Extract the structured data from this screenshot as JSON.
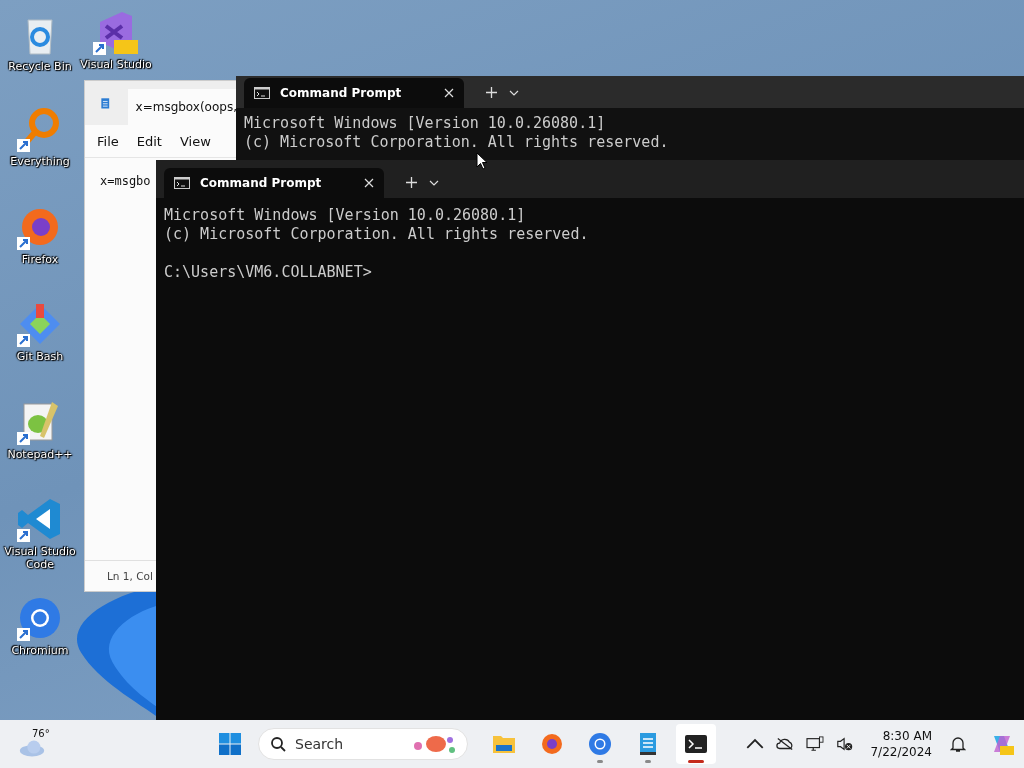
{
  "desktop_icons": [
    {
      "label": "Recycle Bin",
      "kind": "recycle-bin",
      "shortcut": false
    },
    {
      "label": "Visual Studio",
      "kind": "visual-studio",
      "shortcut": true
    },
    {
      "label": "Everything",
      "kind": "everything",
      "shortcut": true
    },
    {
      "label": "Firefox",
      "kind": "firefox",
      "shortcut": true
    },
    {
      "label": "Git Bash",
      "kind": "git-bash",
      "shortcut": true
    },
    {
      "label": "Notepad++",
      "kind": "notepad-plus",
      "shortcut": true
    },
    {
      "label": "Visual Studio Code",
      "kind": "vscode",
      "shortcut": true
    },
    {
      "label": "Chromium",
      "kind": "chromium",
      "shortcut": true
    }
  ],
  "notepad": {
    "tab_title": "x=msgbox(oops,",
    "menu": [
      "File",
      "Edit",
      "View"
    ],
    "content": "x=msgbo",
    "status": "Ln 1, Col"
  },
  "back_terminal": {
    "tab_title": "Command Prompt",
    "lines": [
      "Microsoft Windows [Version 10.0.26080.1]",
      "(c) Microsoft Corporation. All rights reserved."
    ]
  },
  "front_terminal": {
    "tab_title": "Command Prompt",
    "lines": [
      "Microsoft Windows [Version 10.0.26080.1]",
      "(c) Microsoft Corporation. All rights reserved."
    ],
    "prompt": "C:\\Users\\VM6.COLLABNET>"
  },
  "taskbar": {
    "weather": "76°",
    "search": {
      "placeholder": "Search"
    },
    "apps": [
      {
        "kind": "explorer",
        "running": false,
        "selected": false
      },
      {
        "kind": "firefox",
        "running": false,
        "selected": false
      },
      {
        "kind": "chromium",
        "running": true,
        "selected": false
      },
      {
        "kind": "notepad",
        "running": true,
        "selected": false
      },
      {
        "kind": "terminal",
        "running": true,
        "selected": true
      }
    ],
    "time": "8:30 AM",
    "date": "7/22/2024"
  }
}
